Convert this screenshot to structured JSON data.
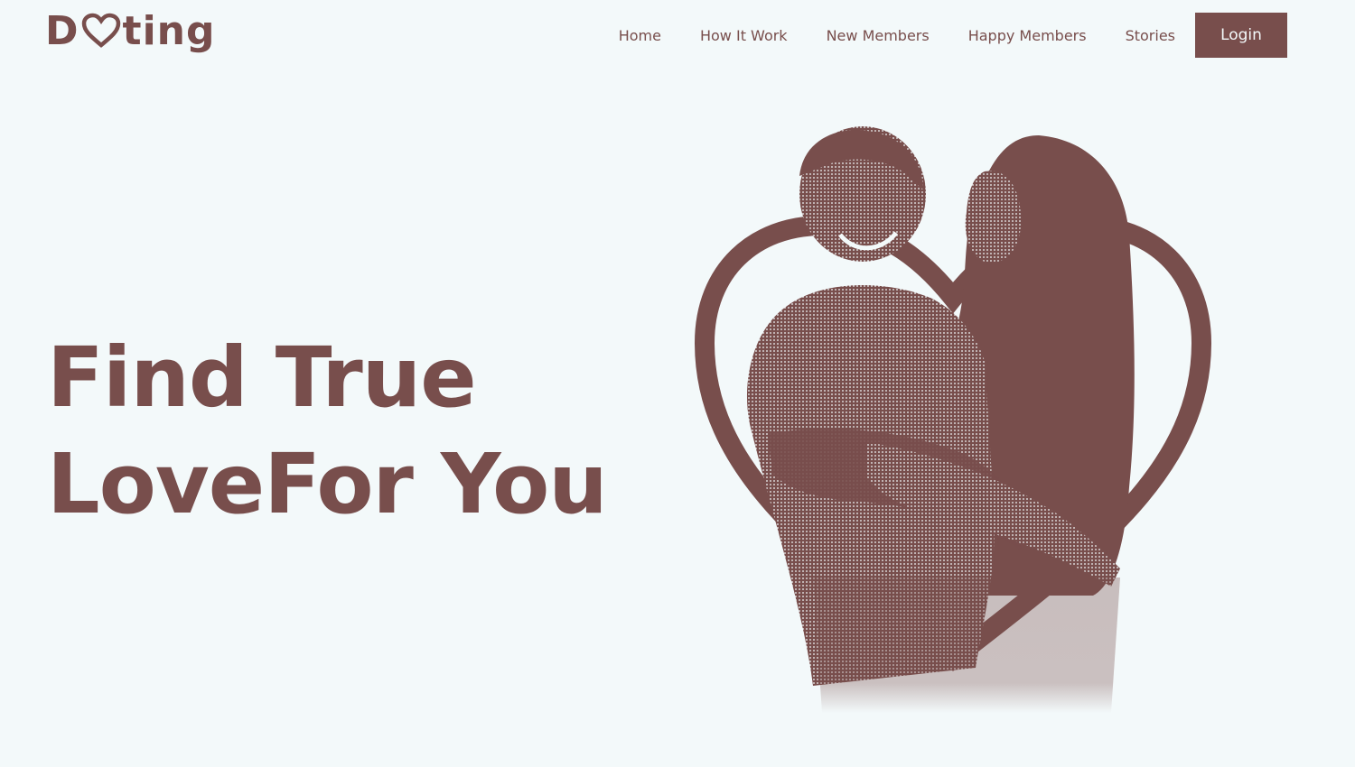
{
  "brand": {
    "logo_prefix": "D",
    "logo_suffix": "ting",
    "logo_icon": "heart-icon"
  },
  "nav": {
    "items": [
      {
        "label": "Home"
      },
      {
        "label": "How It Work"
      },
      {
        "label": "New Members"
      },
      {
        "label": "Happy Members"
      },
      {
        "label": "Stories"
      }
    ],
    "login_label": "Login"
  },
  "hero": {
    "title_line1": "Find True",
    "title_line2": "LoveFor You",
    "image_icon": "couple-heart-illustration"
  },
  "colors": {
    "brand": "#784e4c",
    "background": "#f3f9fa"
  }
}
